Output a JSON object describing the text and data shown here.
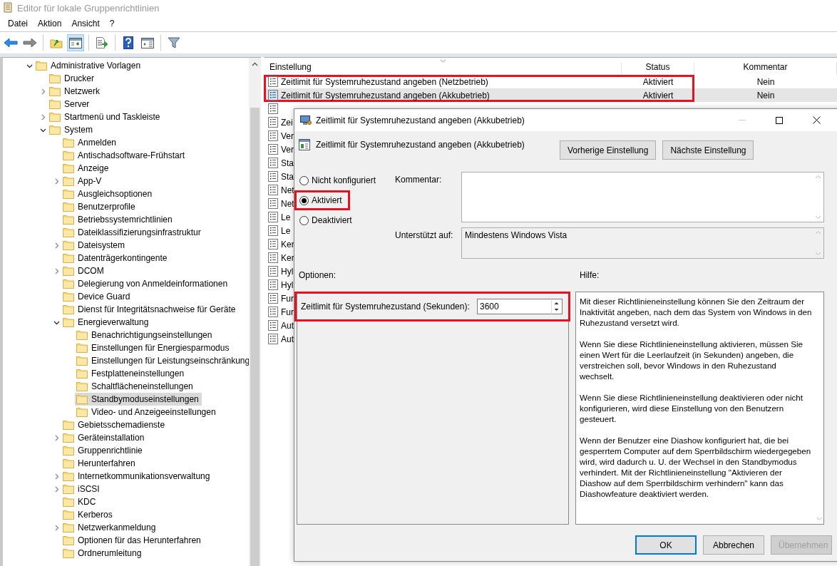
{
  "window": {
    "title": "Editor für lokale Gruppenrichtlinien"
  },
  "menu": [
    "Datei",
    "Aktion",
    "Ansicht",
    "?"
  ],
  "toolbar": [
    {
      "kind": "back",
      "pressed": false
    },
    {
      "kind": "forward",
      "pressed": false
    },
    {
      "kind": "separator"
    },
    {
      "kind": "up",
      "pressed": false
    },
    {
      "kind": "tree",
      "pressed": true
    },
    {
      "kind": "separator"
    },
    {
      "kind": "export",
      "pressed": false
    },
    {
      "kind": "separator"
    },
    {
      "kind": "help",
      "pressed": false
    },
    {
      "kind": "pane",
      "pressed": false
    },
    {
      "kind": "separator"
    },
    {
      "kind": "filter",
      "pressed": false
    }
  ],
  "tree": [
    {
      "label": "Administrative Vorlagen",
      "expanded": true,
      "selected": false,
      "children": [
        {
          "label": "Drucker",
          "selected": false
        },
        {
          "label": "Netzwerk",
          "expanded": false,
          "selected": false
        },
        {
          "label": "Server",
          "selected": false
        },
        {
          "label": "Startmenü und Taskleiste",
          "expanded": false,
          "selected": false
        },
        {
          "label": "System",
          "expanded": true,
          "selected": false,
          "children": [
            {
              "label": "Anmelden",
              "selected": false
            },
            {
              "label": "Antischadsoftware-Frühstart",
              "selected": false
            },
            {
              "label": "Anzeige",
              "selected": false
            },
            {
              "label": "App-V",
              "expanded": false,
              "selected": false
            },
            {
              "label": "Ausgleichsoptionen",
              "selected": false
            },
            {
              "label": "Benutzerprofile",
              "selected": false
            },
            {
              "label": "Betriebssystemrichtlinien",
              "selected": false
            },
            {
              "label": "Dateiklassifizierungsinfrastruktur",
              "selected": false
            },
            {
              "label": "Dateisystem",
              "expanded": false,
              "selected": false
            },
            {
              "label": "Datenträgerkontingente",
              "selected": false
            },
            {
              "label": "DCOM",
              "expanded": false,
              "selected": false
            },
            {
              "label": "Delegierung von Anmeldeinformationen",
              "selected": false
            },
            {
              "label": "Device Guard",
              "selected": false
            },
            {
              "label": "Dienst für Integritätsnachweise für Geräte",
              "selected": false
            },
            {
              "label": "Energieverwaltung",
              "expanded": true,
              "selected": false,
              "children": [
                {
                  "label": "Benachrichtigungseinstellungen",
                  "selected": false
                },
                {
                  "label": "Einstellungen für Energiesparmodus",
                  "selected": false
                },
                {
                  "label": "Einstellungen für Leistungseinschränkung",
                  "selected": false
                },
                {
                  "label": "Festplatteneinstellungen",
                  "selected": false
                },
                {
                  "label": "Schaltflächeneinstellungen",
                  "selected": false
                },
                {
                  "label": "Standbymoduseinstellungen",
                  "selected": true
                },
                {
                  "label": "Video- und Anzeigeeinstellungen",
                  "selected": false
                }
              ]
            },
            {
              "label": "Gebietsschemadienste",
              "selected": false
            },
            {
              "label": "Geräteinstallation",
              "expanded": false,
              "selected": false
            },
            {
              "label": "Gruppenrichtlinie",
              "selected": false
            },
            {
              "label": "Herunterfahren",
              "selected": false
            },
            {
              "label": "Internetkommunikationsverwaltung",
              "expanded": false,
              "selected": false
            },
            {
              "label": "iSCSI",
              "expanded": false,
              "selected": false
            },
            {
              "label": "KDC",
              "selected": false
            },
            {
              "label": "Kerberos",
              "selected": false
            },
            {
              "label": "Netzwerkanmeldung",
              "expanded": false,
              "selected": false
            },
            {
              "label": "Optionen für das Herunterfahren",
              "selected": false
            },
            {
              "label": "Ordnerumleitung",
              "selected": false
            }
          ]
        }
      ]
    }
  ],
  "list": {
    "columns": [
      "Einstellung",
      "Status",
      "Kommentar"
    ],
    "rows": [
      {
        "setting": "Zeitlimit für Systemruhezustand angeben (Netzbetrieb)",
        "status": "Aktiviert",
        "comment": "Nein",
        "selected": false,
        "highlighted": true
      },
      {
        "setting": "Zeitlimit für Systemruhezustand angeben (Akkubetrieb)",
        "status": "Aktiviert",
        "comment": "Nein",
        "selected": true,
        "highlighted": true
      },
      {
        "selected": false,
        "highlighted": false
      },
      {
        "setting": "Zei",
        "selected": false,
        "highlighted": false
      },
      {
        "setting": "Ver",
        "selected": false,
        "highlighted": false
      },
      {
        "setting": "Ver",
        "selected": false,
        "highlighted": false
      },
      {
        "setting": "Sta",
        "selected": false,
        "highlighted": false
      },
      {
        "setting": "Sta",
        "selected": false,
        "highlighted": false
      },
      {
        "setting": "Net",
        "selected": false,
        "highlighted": false
      },
      {
        "setting": "Net",
        "selected": false,
        "highlighted": false
      },
      {
        "setting": "Le",
        "selected": false,
        "highlighted": false
      },
      {
        "setting": "Le",
        "selected": false,
        "highlighted": false
      },
      {
        "setting": "Ker",
        "selected": false,
        "highlighted": false
      },
      {
        "setting": "Ker",
        "selected": false,
        "highlighted": false
      },
      {
        "setting": "Hyl",
        "selected": false,
        "highlighted": false
      },
      {
        "setting": "Hyl",
        "selected": false,
        "highlighted": false
      },
      {
        "setting": "Fur",
        "selected": false,
        "highlighted": false
      },
      {
        "setting": "Fur",
        "selected": false,
        "highlighted": false
      },
      {
        "setting": "Aut",
        "selected": false,
        "highlighted": false
      },
      {
        "setting": "Aut",
        "selected": false,
        "highlighted": false
      }
    ]
  },
  "dialog": {
    "title": "Zeitlimit für Systemruhezustand angeben (Akkubetrieb)",
    "heading": "Zeitlimit für Systemruhezustand angeben (Akkubetrieb)",
    "nav_buttons": [
      "Vorherige Einstellung",
      "Nächste Einstellung"
    ],
    "states": [
      {
        "label": "Nicht konfiguriert",
        "selected": false,
        "highlighted": false
      },
      {
        "label": "Aktiviert",
        "selected": true,
        "highlighted": true
      },
      {
        "label": "Deaktiviert",
        "selected": false,
        "highlighted": false
      }
    ],
    "comment_label": "Kommentar:",
    "supported_label": "Unterstützt auf:",
    "supported_value": "Mindestens Windows Vista",
    "options_label": "Optionen:",
    "help_label": "Hilfe:",
    "option": {
      "label": "Zeitlimit für Systemruhezustand (Sekunden):",
      "value": "3600",
      "highlighted": true
    },
    "help": [
      "Mit dieser Richtlinieneinstellung können Sie den Zeitraum der Inaktivität angeben, nach dem das System von Windows in den Ruhezustand versetzt wird.",
      "Wenn Sie diese Richtlinieneinstellung aktivieren, müssen Sie einen Wert für die Leerlaufzeit (in Sekunden) angeben, die verstreichen soll, bevor Windows in den Ruhezustand wechselt.",
      "Wenn Sie diese Richtlinieneinstellung deaktivieren oder nicht konfigurieren, wird diese Einstellung von den Benutzern gesteuert.",
      "Wenn der Benutzer eine Diashow konfiguriert hat, die bei gesperrtem Computer auf dem Sperrbildschirm wiedergegeben wird, wird dadurch u. U. der Wechsel in den Standbymodus verhindert.  Mit der Richtlinieneinstellung \"Aktivieren der Diashow auf dem Sperrbildschirm verhindern\" kann das Diashowfeature deaktiviert werden."
    ],
    "buttons": [
      {
        "label": "OK",
        "default": true,
        "disabled": false
      },
      {
        "label": "Abbrechen",
        "default": false,
        "disabled": false
      },
      {
        "label": "Übernehmen",
        "default": false,
        "disabled": true
      }
    ]
  }
}
